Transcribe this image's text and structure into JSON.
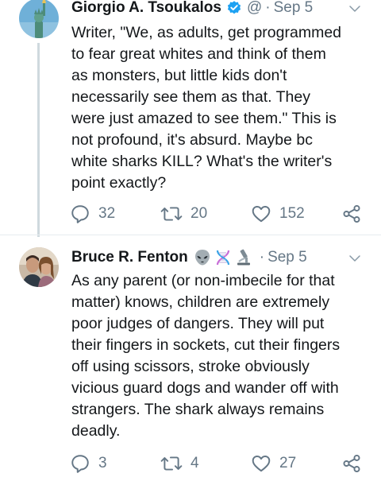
{
  "tweets": [
    {
      "author_name": "Giorgio A. Tsoukalos",
      "handle": "@",
      "separator": "·",
      "date": "Sep 5",
      "text": "Writer, \"We, as adults, get programmed\nto fear great whites and think of them\nas monsters, but little kids don't\nnecessarily see them as that. They\nwere just amazed to see them.\" This is\nnot profound, it's absurd. Maybe bc\nwhite sharks KILL? What's the writer's\npoint exactly?",
      "replies": "32",
      "retweets": "20",
      "likes": "152",
      "avatar_icon": "statue-of-liberty-avatar",
      "verified_icon": "verified-badge-icon"
    },
    {
      "author_name": "Bruce R. Fenton",
      "separator": "·",
      "date": "Sep 5",
      "emojis": [
        "alien-emoji",
        "dna-emoji",
        "microscope-emoji"
      ],
      "text": "As any parent (or non-imbecile for that\nmatter) knows, children are extremely\npoor judges of dangers. They will put\ntheir fingers in sockets, cut their fingers\noff using scissors, stroke obviously\nvicious guard dogs and wander off with\nstrangers. The shark always remains\ndeadly.",
      "replies": "3",
      "retweets": "4",
      "likes": "27",
      "avatar_icon": "couple-photo-avatar"
    }
  ],
  "colors": {
    "text": "#14171a",
    "muted": "#657786",
    "verified": "#1da1f2",
    "thread": "#cfd9de"
  }
}
